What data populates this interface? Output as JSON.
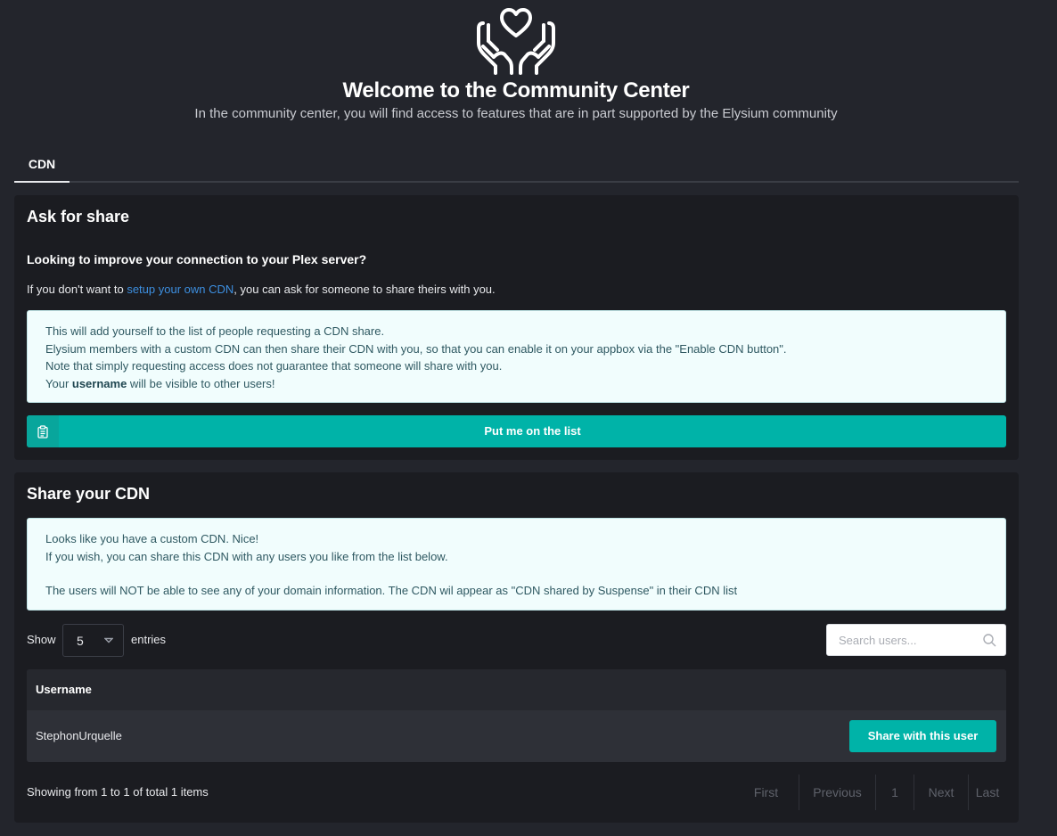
{
  "hero": {
    "title": "Welcome to the Community Center",
    "subtitle": "In the community center, you will find access to features that are in part supported by the Elysium community",
    "icon": "heart-hands-icon"
  },
  "tabs": [
    {
      "label": "CDN",
      "active": true
    }
  ],
  "ask_card": {
    "title": "Ask for share",
    "heading": "Looking to improve your connection to your Plex server?",
    "text_before_link": "If you don't want to ",
    "link_text": "setup your own CDN",
    "text_after_link": ", you can ask for someone to share theirs with you.",
    "info": {
      "line1": "This will add yourself to the list of people requesting a CDN share.",
      "line2": "Elysium members with a custom CDN can then share their CDN with you, so that you can enable it on your appbox via the \"Enable CDN button\".",
      "line3": "Note that simply requesting access does not guarantee that someone will share with you.",
      "line4_prefix": "Your ",
      "line4_bold": "username",
      "line4_suffix": " will be visible to other users!"
    },
    "button_label": "Put me on the list",
    "button_icon": "clipboard-icon"
  },
  "share_card": {
    "title": "Share your CDN",
    "info": {
      "line1": "Looks like you have a custom CDN. Nice!",
      "line2": "If you wish, you can share this CDN with any users you like from the list below.",
      "line3": "The users will NOT be able to see any of your domain information. The CDN wil appear as \"CDN shared by Suspense\" in their CDN list"
    },
    "show_label": "Show",
    "entries_value": "5",
    "entries_label": "entries",
    "search_placeholder": "Search users...",
    "table": {
      "columns": [
        "Username"
      ],
      "rows": [
        {
          "username": "StephonUrquelle",
          "action_label": "Share with this user"
        }
      ]
    },
    "showing_text": "Showing from 1 to 1 of total 1 items",
    "pagination": {
      "first": "First",
      "previous": "Previous",
      "page": "1",
      "next": "Next",
      "last": "Last"
    }
  },
  "colors": {
    "background": "#23252c",
    "card": "#1b1c21",
    "accent": "#00b3a8",
    "link": "#3d8fe0",
    "info_bg": "#f1fdfd"
  }
}
